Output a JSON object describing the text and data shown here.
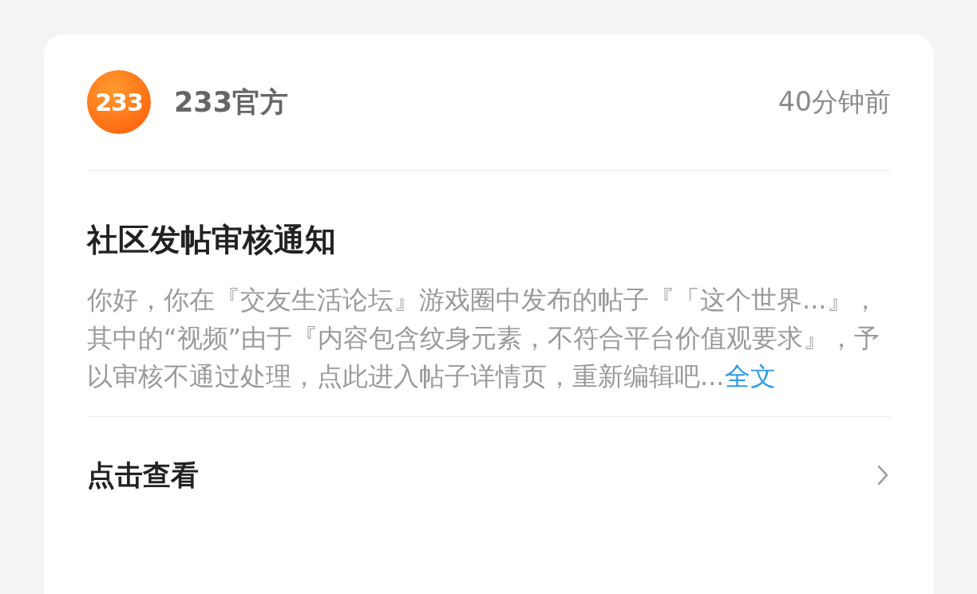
{
  "card": {
    "sender": {
      "avatar_text": "233",
      "name": "233官方"
    },
    "time": "40分钟前",
    "title": "社区发帖审核通知",
    "body": "你好，你在『交友生活论坛』游戏圈中发布的帖子『「这个世界...』，其中的“视频”由于『内容包含纹身元素，不符合平台价值观要求』，予以审核不通过处理，点此进入帖子详情页，重新编辑吧...",
    "more_link": "全文",
    "action": "点击查看"
  }
}
